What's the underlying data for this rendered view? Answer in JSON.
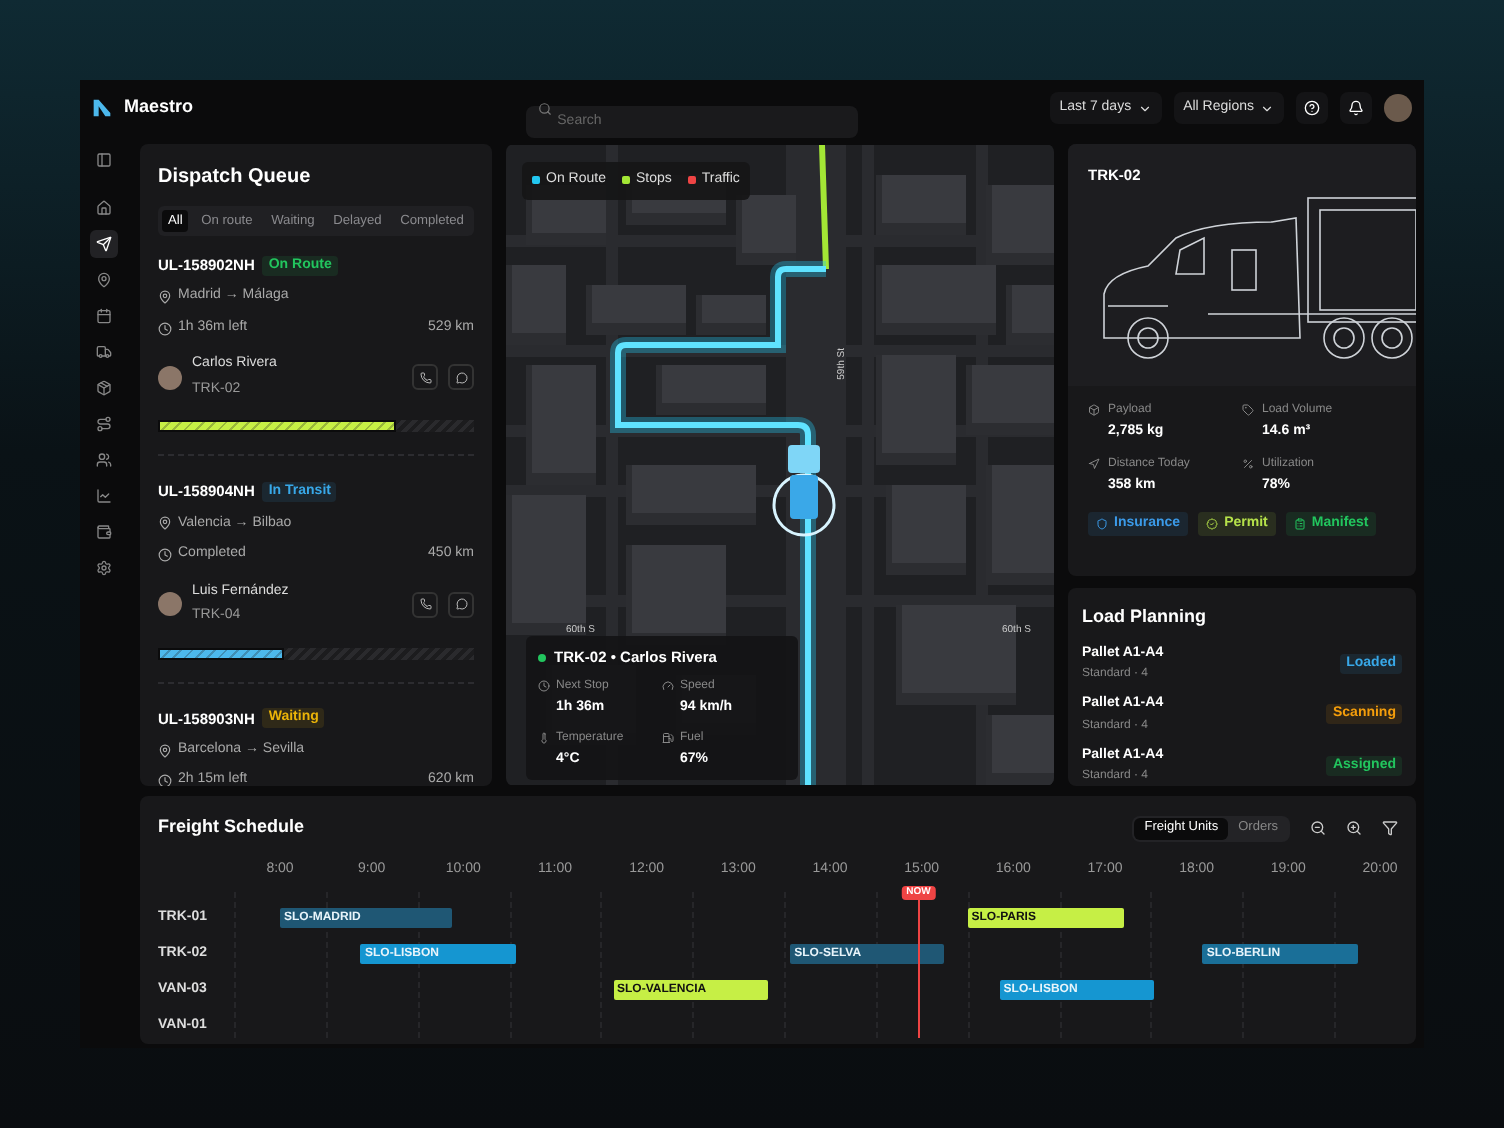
{
  "brand": {
    "name": "Maestro"
  },
  "search": {
    "placeholder": "Search"
  },
  "filters": [
    {
      "label": "Last 7 days"
    },
    {
      "label": "All Regions"
    }
  ],
  "sidebar": {
    "items": [
      {
        "selected": false
      },
      {
        "selected": false
      },
      {
        "selected": true
      },
      {
        "selected": false
      },
      {
        "selected": false
      },
      {
        "selected": false
      },
      {
        "selected": false
      },
      {
        "selected": false
      },
      {
        "selected": false
      },
      {
        "selected": false
      },
      {
        "selected": false
      },
      {
        "selected": false
      }
    ]
  },
  "dispatch": {
    "title": "Dispatch Queue",
    "tabs": [
      {
        "label": "All",
        "selected": true
      },
      {
        "label": "On route",
        "selected": false
      },
      {
        "label": "Waiting",
        "selected": false
      },
      {
        "label": "Delayed",
        "selected": false
      },
      {
        "label": "Completed",
        "selected": false
      }
    ],
    "orders": [
      {
        "id": "UL-158902NH",
        "status": "On Route",
        "color": "#22c55e",
        "route": "Madrid → Málaga",
        "eta": "1h 36m left",
        "distance": "529 km",
        "driver": "Carlos Rivera",
        "vehicle": "TRK-02",
        "progress": {
          "level": 0.75,
          "color": "#c6ef45"
        }
      },
      {
        "id": "UL-158904NH",
        "status": "In Transit",
        "color": "#38a8e8",
        "route": "Valencia → Bilbao",
        "eta": "Completed",
        "distance": "450 km",
        "driver": "Luis Fernández",
        "vehicle": "TRK-04",
        "progress": {
          "level": 0.4,
          "color": "#4cb8ec"
        }
      },
      {
        "id": "UL-158903NH",
        "status": "Waiting",
        "color": "#eab308",
        "route": "Barcelona → Sevilla",
        "eta": "2h 15m left",
        "distance": "620 km"
      }
    ]
  },
  "map": {
    "legend": [
      {
        "label": "On Route",
        "color": "#22c7f0"
      },
      {
        "label": "Stops",
        "color": "#a3e635"
      },
      {
        "label": "Traffic",
        "color": "#ef4444"
      }
    ],
    "street_labels": [
      "59th St",
      "60th S",
      "60th S"
    ],
    "vehicle": {
      "title": "TRK-02 • Carlos Rivera",
      "color": "#22c55e",
      "stats": [
        {
          "label": "Next Stop",
          "value": "1h 36m"
        },
        {
          "label": "Speed",
          "value": "94 km/h"
        },
        {
          "label": "Temperature",
          "value": "4°C"
        },
        {
          "label": "Fuel",
          "value": "67%"
        }
      ]
    }
  },
  "truck": {
    "title": "TRK-02",
    "stats": [
      {
        "label": "Payload",
        "value": "2,785 kg"
      },
      {
        "label": "Load Volume",
        "value": "14.6 m³"
      },
      {
        "label": "Distance Today",
        "value": "358 km"
      },
      {
        "label": "Utilization",
        "value": "78%"
      }
    ],
    "documents": [
      {
        "label": "Insurance",
        "color": "#3b9ae8"
      },
      {
        "label": "Permit",
        "color": "#b5e14a"
      },
      {
        "label": "Manifest",
        "color": "#22c55e"
      }
    ]
  },
  "load_planning": {
    "title": "Load Planning",
    "items": [
      {
        "name": "Pallet A1-A4",
        "detail": "Standard · 4",
        "status": "Loaded",
        "color": "#38a8e8"
      },
      {
        "name": "Pallet A1-A4",
        "detail": "Standard · 4",
        "status": "Scanning",
        "color": "#f59e0b"
      },
      {
        "name": "Pallet A1-A4",
        "detail": "Standard · 4",
        "status": "Assigned",
        "color": "#22c55e"
      }
    ]
  },
  "schedule": {
    "title": "Freight Schedule",
    "views": [
      {
        "label": "Freight Units",
        "selected": true
      },
      {
        "label": "Orders",
        "selected": false
      }
    ],
    "hours": [
      "8:00",
      "9:00",
      "10:00",
      "11:00",
      "12:00",
      "13:00",
      "14:00",
      "15:00",
      "16:00",
      "17:00",
      "18:00",
      "19:00",
      "20:00"
    ],
    "now": {
      "label": "NOW"
    },
    "rows": [
      {
        "label": "TRK-01",
        "trips": [
          {
            "label": "SLO-MADRID",
            "color": "#1f5774"
          },
          {
            "label": "SLO-PARIS",
            "color": "#c6ef45"
          }
        ]
      },
      {
        "label": "TRK-02",
        "trips": [
          {
            "label": "SLO-LISBON",
            "color": "#1596d1"
          },
          {
            "label": "SLO-SELVA",
            "color": "#1f5774"
          },
          {
            "label": "SLO-BERLIN",
            "color": "#1a6f98"
          }
        ]
      },
      {
        "label": "VAN-03",
        "trips": [
          {
            "label": "SLO-VALENCIA",
            "color": "#c6ef45"
          },
          {
            "label": "SLO-LISBON",
            "color": "#1596d1"
          }
        ]
      },
      {
        "label": "VAN-01",
        "trips": []
      }
    ]
  }
}
